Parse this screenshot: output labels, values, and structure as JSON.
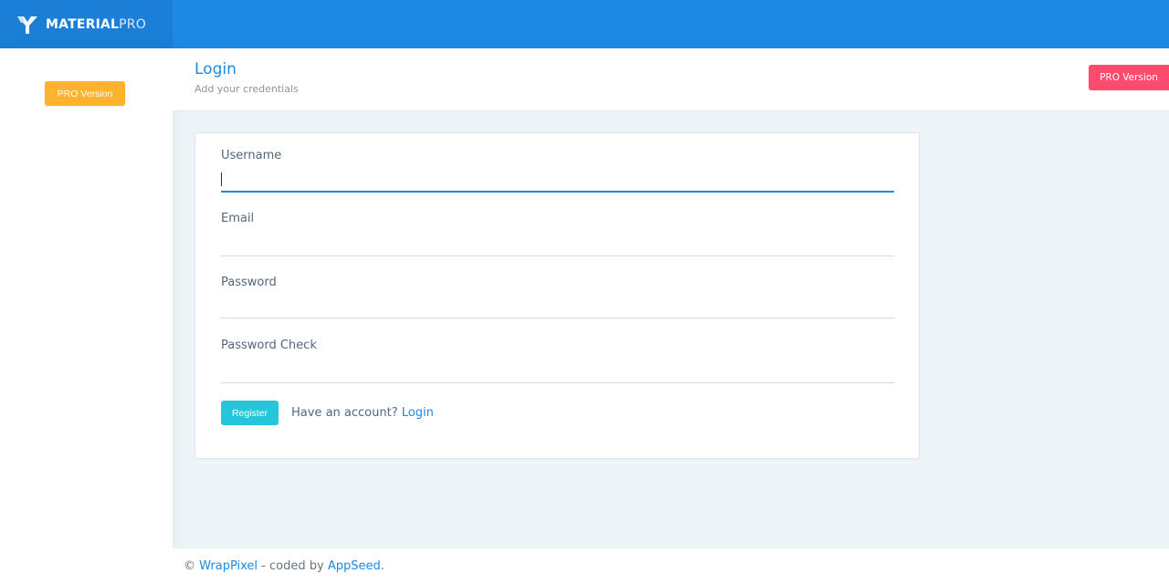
{
  "brand": {
    "name_bold": "MATERIAL",
    "name_light": "PRO"
  },
  "sidebar": {
    "pro_button": "PRO Version"
  },
  "header": {
    "title": "Login",
    "subtitle": "Add your credentials",
    "pro_button": "PRO Version"
  },
  "form": {
    "username_label": "Username",
    "username_value": "",
    "email_label": "Email",
    "email_value": "",
    "password_label": "Password",
    "password_value": "",
    "password_check_label": "Password Check",
    "password_check_value": "",
    "register_button": "Register",
    "account_prompt": "Have an account?",
    "login_link": "Login"
  },
  "footer": {
    "copyright": "©",
    "company_link": "WrapPixel",
    "coded_by": " - coded by ",
    "author_link": "AppSeed",
    "end": "."
  },
  "colors": {
    "topbar": "#1e88e5",
    "warning": "#ffb22b",
    "danger": "#fc4b6c",
    "info": "#26c6da"
  }
}
